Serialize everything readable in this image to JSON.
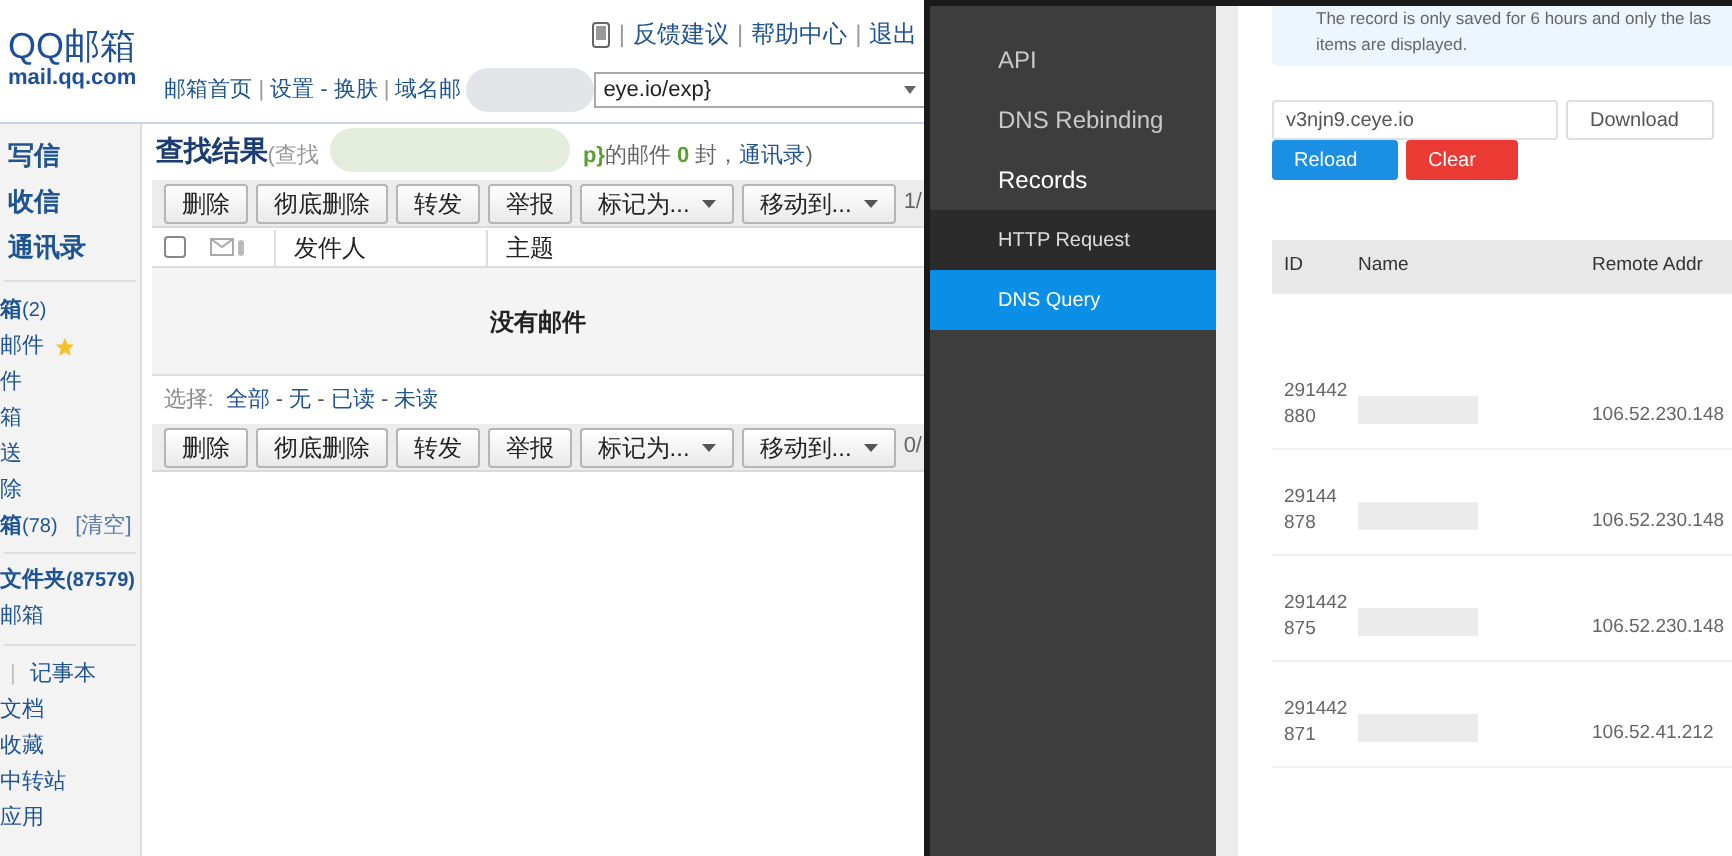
{
  "mail": {
    "brand": "QQ邮箱",
    "domain": "mail.qq.com",
    "top_links": [
      "反馈建议",
      "帮助中心",
      "退出"
    ],
    "link_sep": "|",
    "nav_links": [
      "邮箱首页",
      "设置 - 换肤",
      "域名邮"
    ],
    "search_field": {
      "value": "eye.io/exp}"
    },
    "sidebar": {
      "primary": [
        "写信",
        "收信",
        "通讯录"
      ],
      "folders": [
        {
          "label": "箱",
          "count": "(2)",
          "bold": true,
          "starred": false
        },
        {
          "label": "邮件",
          "starred": true,
          "bold": false
        },
        {
          "label": "件",
          "starred": false,
          "bold": false
        },
        {
          "label": "箱",
          "starred": false,
          "bold": false
        },
        {
          "label": "送",
          "starred": false,
          "bold": false
        },
        {
          "label": "除",
          "starred": false,
          "bold": false
        },
        {
          "label": "箱",
          "count": "(78)",
          "bold": true,
          "starred": false,
          "action": "[清空]"
        }
      ],
      "my_folders": [
        {
          "label": "文件夹",
          "count": "(87579)",
          "bold": true
        },
        {
          "label": "邮箱",
          "bold": false
        }
      ],
      "tools_sep": "|",
      "tools_first": "记事本",
      "tools": [
        "文档",
        "收藏",
        "中转站",
        "应用"
      ]
    },
    "result": {
      "title": "查找结果",
      "prefix": "(查找",
      "suffix_start": "p}的邮件 ",
      "count": "0",
      "suffix_end": " 封，",
      "link": "通讯录",
      "close": ")"
    },
    "toolbar_top": [
      {
        "label": "删除",
        "kind": "plain"
      },
      {
        "label": "彻底删除",
        "kind": "plain"
      },
      {
        "label": "转发",
        "kind": "plain"
      },
      {
        "label": "举报",
        "kind": "plain"
      },
      {
        "label": "标记为...",
        "kind": "dropdown"
      },
      {
        "label": "移动到...",
        "kind": "dropdown"
      }
    ],
    "toolbar_bottom": [
      {
        "label": "删除",
        "kind": "plain"
      },
      {
        "label": "彻底删除",
        "kind": "plain"
      },
      {
        "label": "转发",
        "kind": "plain"
      },
      {
        "label": "举报",
        "kind": "plain"
      },
      {
        "label": "标记为...",
        "kind": "dropdown"
      },
      {
        "label": "移动到...",
        "kind": "dropdown"
      }
    ],
    "select_all": {
      "checked": false
    },
    "toolbar_page_top": "1/",
    "toolbar_page_bottom": "0/",
    "columns": [
      "发件人",
      "主题"
    ],
    "empty": "没有邮件",
    "select_label": "选择:",
    "select_options": [
      "全部",
      "无",
      "已读",
      "未读"
    ],
    "select_sep": " - "
  },
  "ceye": {
    "nav": [
      {
        "label": "API",
        "kind": "item",
        "selected": false
      },
      {
        "label": "DNS Rebinding",
        "kind": "item",
        "selected": false
      },
      {
        "label": "Records",
        "kind": "header",
        "selected": false
      },
      {
        "label": "HTTP Request",
        "kind": "sub",
        "selected": false
      },
      {
        "label": "DNS Query",
        "kind": "sub",
        "selected": true
      }
    ],
    "notice": "The record is only saved for 6 hours and only the las items are displayed.",
    "filter": {
      "value": "v3njn9.ceye.io"
    },
    "buttons": [
      {
        "label": "Download",
        "kind": "outline"
      },
      {
        "label": "Reload",
        "kind": "primary"
      },
      {
        "label": "Clear",
        "kind": "danger"
      }
    ],
    "columns": [
      "ID",
      "Name",
      "Remote Addr"
    ],
    "rows": [
      {
        "id": [
          "291442",
          "880"
        ],
        "remote": "106.52.230.148"
      },
      {
        "id": [
          "29144",
          "878"
        ],
        "remote": "106.52.230.148"
      },
      {
        "id": [
          "291442",
          "875"
        ],
        "remote": "106.52.230.148"
      },
      {
        "id": [
          "291442",
          "871"
        ],
        "remote": "106.52.41.212"
      }
    ]
  }
}
